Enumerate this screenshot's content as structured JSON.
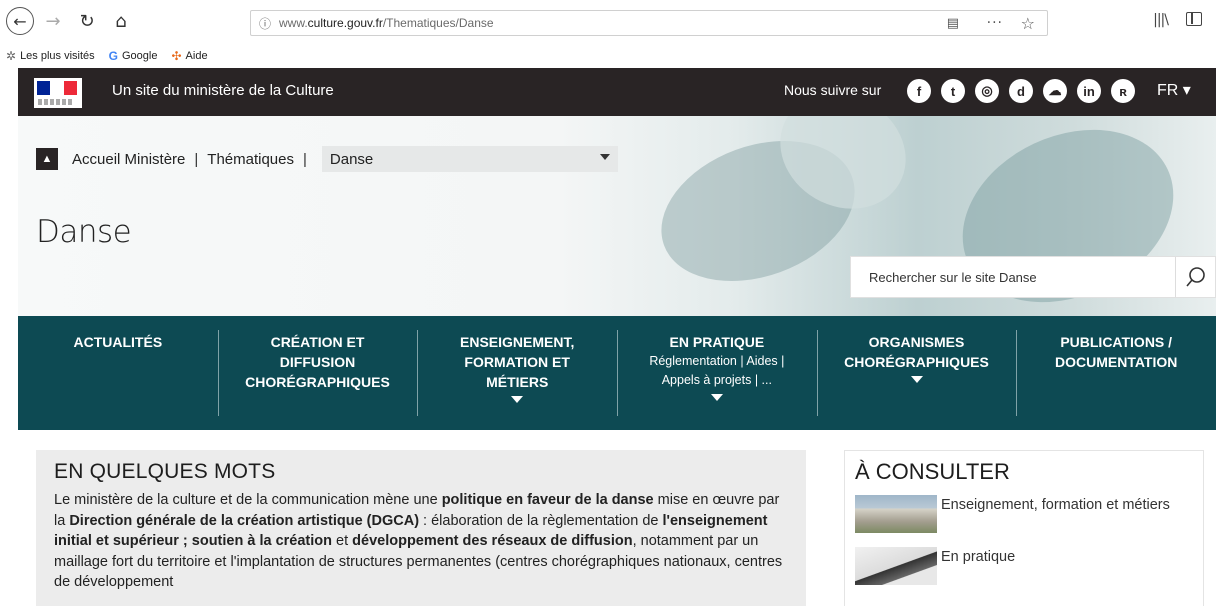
{
  "browser": {
    "url_prefix": "www.",
    "url_domain": "culture.gouv.fr",
    "url_path": "/Thematiques/Danse",
    "bookmarks": [
      {
        "label": "Les plus visités",
        "icon": "gear-icon"
      },
      {
        "label": "Google",
        "icon": "google-icon"
      },
      {
        "label": "Aide",
        "icon": "help-icon"
      }
    ]
  },
  "ministry_bar": {
    "title": "Un site du ministère de la Culture",
    "follow_label": "Nous suivre sur",
    "socials": [
      {
        "name": "facebook",
        "glyph": "f"
      },
      {
        "name": "twitter",
        "glyph": "t"
      },
      {
        "name": "instagram",
        "glyph": "◎"
      },
      {
        "name": "dailymotion",
        "glyph": "d"
      },
      {
        "name": "soundcloud",
        "glyph": "☁"
      },
      {
        "name": "linkedin",
        "glyph": "in"
      },
      {
        "name": "rss",
        "glyph": "ʀ"
      }
    ],
    "language": "FR ▾"
  },
  "breadcrumb": {
    "home_label": "Accueil Ministère",
    "level2": "Thématiques",
    "current": "Danse"
  },
  "page_title": "Danse",
  "search": {
    "placeholder": "Rechercher sur le site Danse"
  },
  "main_nav": [
    {
      "label": "ACTUALITÉS",
      "sub": "",
      "caret": false
    },
    {
      "label": "CRÉATION ET\nDIFFUSION\nCHORÉGRAPHIQUES",
      "sub": "",
      "caret": false
    },
    {
      "label": "ENSEIGNEMENT,\nFORMATION ET\nMÉTIERS",
      "sub": "",
      "caret": true
    },
    {
      "label": "EN PRATIQUE",
      "sub": "Réglementation | Aides |\nAppels à projets | ...",
      "caret": true
    },
    {
      "label": "ORGANISMES\nCHORÉGRAPHIQUES",
      "sub": "",
      "caret": true
    },
    {
      "label": "PUBLICATIONS /\nDOCUMENTATION",
      "sub": "",
      "caret": false
    }
  ],
  "intro": {
    "heading": "EN QUELQUES MOTS",
    "p1": "Le ministère de la culture et de la communication mène une ",
    "b1": "politique en faveur de la danse",
    "p2": " mise en œuvre par la ",
    "b2": "Direction générale de la création artistique (DGCA)",
    "p3": " : élaboration de la règlementation de ",
    "b3": "l'enseignement initial et supérieur ; soutien à la création",
    "p4": " et ",
    "b4": "développement des réseaux de diffusion",
    "p5": ", notamment par un maillage fort du territoire et l'implantation de structures permanentes (centres chorégraphiques nationaux, centres de développement"
  },
  "consult": {
    "heading": "À CONSULTER",
    "items": [
      {
        "label": "Enseignement, formation et métiers"
      },
      {
        "label": "En pratique"
      }
    ]
  },
  "colors": {
    "ministry_bar": "#292425",
    "nav_bg": "#0d4a53",
    "intro_bg": "#ececec"
  }
}
